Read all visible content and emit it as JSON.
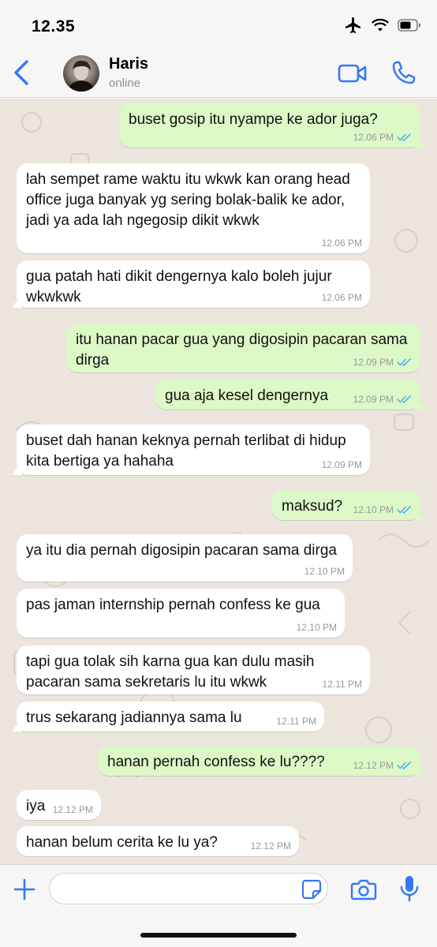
{
  "status_bar": {
    "time": "12.35"
  },
  "header": {
    "contact_name": "Haris",
    "contact_status": "online"
  },
  "messages": [
    {
      "dir": "out",
      "text": "buset gosip itu nyampe ke ador juga?",
      "time": "12.06 PM",
      "read": true
    },
    {
      "dir": "in",
      "text": "lah sempet rame waktu itu wkwk kan orang head office juga banyak yg sering bolak-balik ke ador, jadi ya ada lah ngegosip dikit wkwk",
      "time": "12.06 PM"
    },
    {
      "dir": "in",
      "text": "gua patah hati dikit dengernya kalo boleh jujur wkwkwk",
      "time": "12.06 PM"
    },
    {
      "dir": "out",
      "text": "itu hanan pacar gua yang digosipin pacaran sama dirga",
      "time": "12.09 PM",
      "read": true
    },
    {
      "dir": "out",
      "text": "gua aja kesel dengernya",
      "time": "12.09 PM",
      "read": true
    },
    {
      "dir": "in",
      "text": "buset dah hanan keknya pernah terlibat di hidup kita bertiga ya hahaha",
      "time": "12.09 PM"
    },
    {
      "dir": "out",
      "text": "maksud?",
      "time": "12.10 PM",
      "read": true
    },
    {
      "dir": "in",
      "text": "ya itu dia pernah digosipin pacaran sama dirga",
      "time": "12.10 PM"
    },
    {
      "dir": "in",
      "text": "pas jaman internship pernah confess ke gua",
      "time": "12.10 PM"
    },
    {
      "dir": "in",
      "text": "tapi gua tolak sih karna gua kan dulu masih pacaran sama sekretaris lu itu wkwk",
      "time": "12.11 PM"
    },
    {
      "dir": "in",
      "text": "trus sekarang jadiannya sama lu",
      "time": "12.11 PM"
    },
    {
      "dir": "out",
      "text": "hanan pernah confess ke lu????",
      "time": "12.12 PM",
      "read": true
    },
    {
      "dir": "in",
      "text": "iya",
      "time": "12.12 PM"
    },
    {
      "dir": "in",
      "text": "hanan belum cerita ke lu ya?",
      "time": "12.12 PM"
    }
  ],
  "composer": {
    "input_value": "",
    "input_placeholder": ""
  },
  "colors": {
    "accent": "#3478f6",
    "outgoing_bubble": "#dcf8c6",
    "incoming_bubble": "#ffffff",
    "chat_background": "#ece5dd",
    "read_ticks": "#4fb6ec"
  },
  "icons": {
    "back": "chevron-left-icon",
    "video": "video-camera-icon",
    "call": "phone-icon",
    "add": "plus-icon",
    "sticker": "sticker-icon",
    "camera": "camera-icon",
    "mic": "microphone-icon",
    "airplane": "airplane-icon",
    "wifi": "wifi-icon",
    "battery": "battery-icon"
  }
}
